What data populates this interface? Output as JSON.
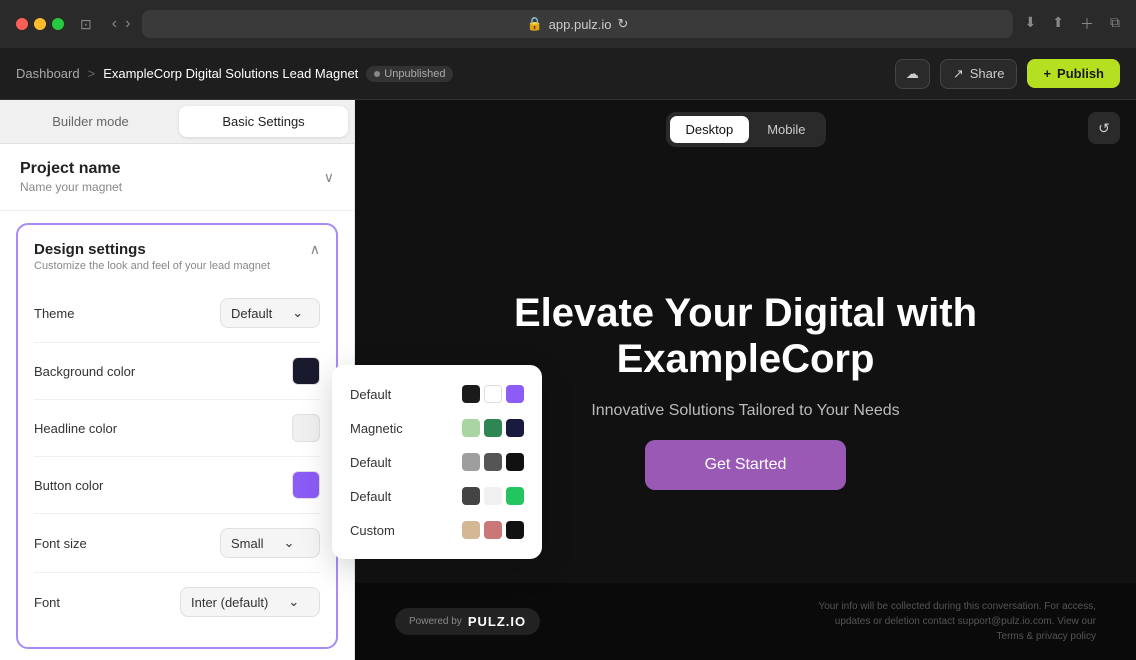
{
  "browser": {
    "url": "app.pulz.io",
    "lock_icon": "🔒"
  },
  "toolbar": {
    "dashboard_label": "Dashboard",
    "breadcrumb_separator": ">",
    "project_name": "ExampleCorp Digital Solutions Lead Magnet",
    "status": "Unpublished",
    "cloud_icon": "☁",
    "share_icon": "↗",
    "share_label": "Share",
    "publish_icon": "+",
    "publish_label": "Publish"
  },
  "left_panel": {
    "tab_builder": "Builder mode",
    "tab_settings": "Basic Settings",
    "project_section": {
      "title": "Project name",
      "subtitle": "Name your magnet"
    },
    "design_section": {
      "title": "Design settings",
      "subtitle": "Customize the look and feel of your lead magnet",
      "theme_label": "Theme",
      "theme_value": "Default",
      "background_label": "Background color",
      "headline_label": "Headline color",
      "button_label": "Button color",
      "button_color": "#8b5cf6",
      "background_color": "#1a1a2e",
      "headline_color": "#f0f0f0",
      "font_size_label": "Font size",
      "font_size_value": "Small",
      "font_label": "Font",
      "font_value": "Inter (default)"
    }
  },
  "theme_dropdown": {
    "options": [
      {
        "name": "Default",
        "swatches": [
          "#1a1a1a",
          "#ffffff",
          "#8b5cf6"
        ]
      },
      {
        "name": "Magnetic",
        "swatches": [
          "#a8d5a2",
          "#2d8653",
          "#1a1a3e"
        ]
      },
      {
        "name": "Default",
        "swatches": [
          "#9e9e9e",
          "#555555",
          "#111111"
        ]
      },
      {
        "name": "Default",
        "swatches": [
          "#444444",
          "#f0f0f0",
          "#22c55e"
        ]
      },
      {
        "name": "Custom",
        "swatches": [
          "#d4b896",
          "#c97777",
          "#111111"
        ]
      }
    ]
  },
  "preview": {
    "desktop_tab": "Desktop",
    "mobile_tab": "Mobile",
    "refresh_icon": "↺",
    "headline": "Elevate Your Digital with ExampleCorp",
    "subheadline": "Innovative Solutions Tailored to Your Needs",
    "cta_label": "Get Started",
    "powered_text": "Powered by",
    "brand_name": "PULZ.IO",
    "privacy_text": "Your info will be collected during this conversation. For access, updates or deletion contact support@pulz.io.com. View our Terms & privacy policy"
  }
}
